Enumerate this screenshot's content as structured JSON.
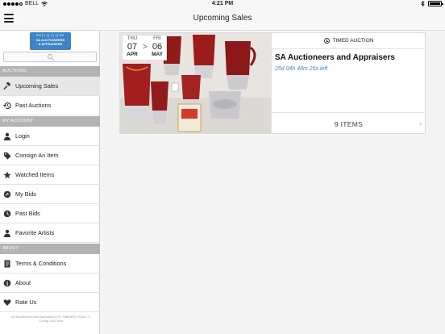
{
  "status_bar": {
    "carrier": "BELL",
    "time": "4:21 PM",
    "battery_level": 0.95
  },
  "nav": {
    "title": "Upcoming Sales"
  },
  "sidebar": {
    "logo_arches": "ꟷ∩∩∩∩ꟷ",
    "logo_name_line1": "SA AUCTIONEERS",
    "logo_name_line2": "& APPRAISERS",
    "search_placeholder": "",
    "sections": {
      "auctions": "AUCTIONS",
      "my_account": "MY ACCOUNT",
      "about": "ABOUT"
    },
    "items": {
      "upcoming_sales": "Upcoming Sales",
      "past_auctions": "Past Auctions",
      "login": "Login",
      "consign": "Consign An Item",
      "watched": "Watched Items",
      "my_bids": "My Bids",
      "past_bids": "Past Bids",
      "favorite_artists": "Favorite Artists",
      "terms": "Terms & Conditions",
      "about": "About",
      "rate_us": "Rate Us"
    },
    "footer_line1": "SA Auctioneers and Appraisers LIT: 7b8b3fb0 2303c7 ©",
    "footer_line2": "Config: 2u0748a"
  },
  "sale": {
    "start": {
      "dow": "THU",
      "day": "07",
      "month": "APR"
    },
    "end": {
      "dow": "FRI",
      "day": "06",
      "month": "MAY"
    },
    "arrow": ">",
    "auction_type": "TIMED AUCTION",
    "auctioneer": "SA Auctioneers and Appraisers",
    "time_left": "25d 04h 48m 26s left",
    "items": "9 ITEMS"
  },
  "icons": {
    "upcoming_sales": "gavel-icon",
    "past_auctions": "history-icon",
    "login": "person-icon",
    "consign": "tag-icon",
    "watched": "star-icon",
    "my_bids": "bid-icon",
    "past_bids": "bid-history-icon",
    "favorite_artists": "artist-icon",
    "terms": "document-icon",
    "about": "info-icon",
    "rate_us": "heart-icon"
  },
  "colors": {
    "accent": "#3a8ad0",
    "logo_bg": "#3d84c9",
    "section_header": "#b3b3b3"
  }
}
